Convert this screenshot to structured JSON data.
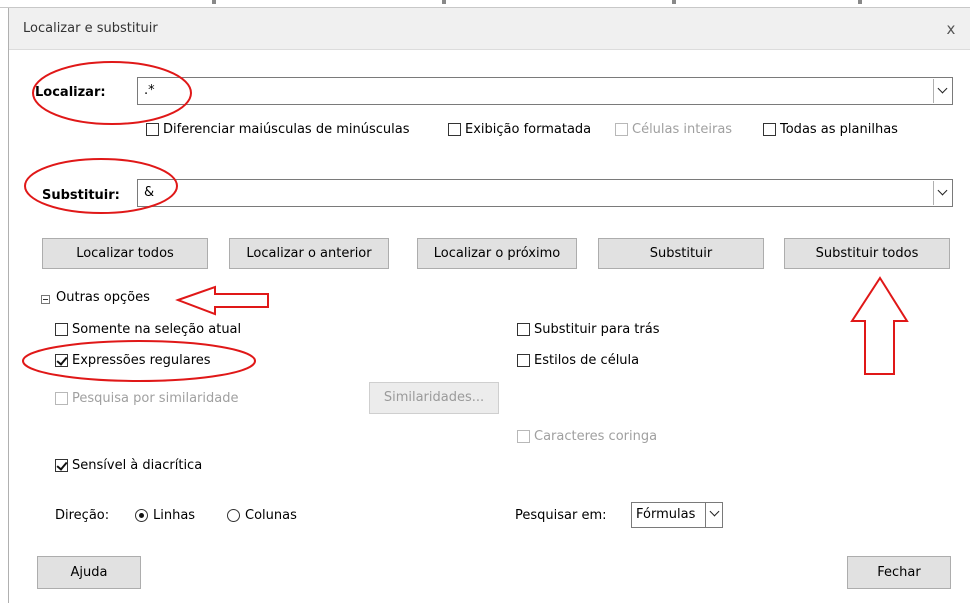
{
  "dialog": {
    "title": "Localizar e substituir",
    "close_glyph": "x"
  },
  "find": {
    "label": "Localizar:",
    "value": ".*"
  },
  "options_row": {
    "match_case": "Diferenciar maiúsculas de minúsculas",
    "formatted_display": "Exibição formatada",
    "entire_cells": "Células inteiras",
    "all_sheets": "Todas as planilhas"
  },
  "replace": {
    "label": "Substituir:",
    "value": "&"
  },
  "buttons": {
    "find_all": "Localizar todos",
    "find_previous": "Localizar o anterior",
    "find_next": "Localizar o próximo",
    "replace": "Substituir",
    "replace_all": "Substituir todos"
  },
  "other_options": {
    "label": "Outras opções",
    "current_selection_only": "Somente na seleção atual",
    "regular_expressions": "Expressões regulares",
    "similarity_search": "Pesquisa por similaridade",
    "similarities_button": "Similaridades...",
    "replace_backwards": "Substituir para trás",
    "cell_styles": "Estilos de célula",
    "wildcards": "Caracteres coringa",
    "diacritic_sensitive": "Sensível à diacrítica"
  },
  "direction": {
    "label": "Direção:",
    "rows": "Linhas",
    "columns": "Colunas",
    "selected": "rows"
  },
  "search_in": {
    "label": "Pesquisar em:",
    "value": "Fórmulas"
  },
  "footer": {
    "help": "Ajuda",
    "close": "Fechar"
  },
  "checked": {
    "match_case": false,
    "formatted_display": false,
    "entire_cells": false,
    "all_sheets": false,
    "current_selection_only": false,
    "regular_expressions": true,
    "similarity_search": false,
    "replace_backwards": false,
    "cell_styles": false,
    "wildcards": false,
    "diacritic_sensitive": true
  },
  "colors": {
    "annotation_red": "#e01818",
    "button_face": "#e1e1e1",
    "titlebar": "#f0f0f0"
  }
}
